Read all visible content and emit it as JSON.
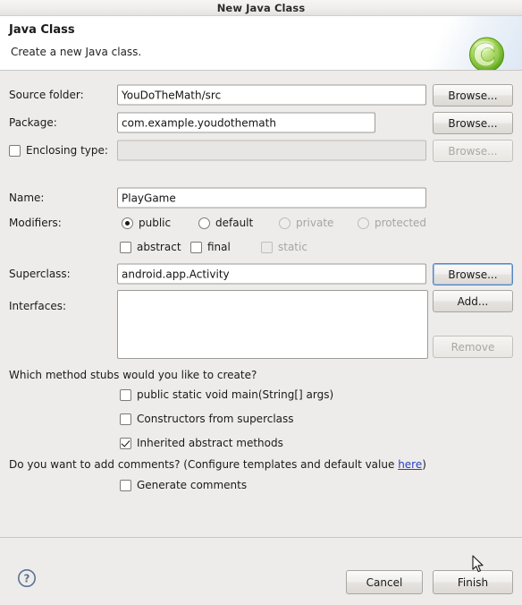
{
  "window": {
    "title": "New Java Class"
  },
  "header": {
    "title": "Java Class",
    "subtitle": "Create a new Java class.",
    "icon": "java-class-icon"
  },
  "form": {
    "source_folder": {
      "label": "Source folder:",
      "value": "YouDoTheMath/src",
      "browse_label": "Browse..."
    },
    "package": {
      "label": "Package:",
      "value": "com.example.youdothemath",
      "browse_label": "Browse..."
    },
    "enclosing_type": {
      "label": "Enclosing type:",
      "value": "",
      "checked": false,
      "browse_label": "Browse...",
      "enabled": false
    },
    "name": {
      "label": "Name:",
      "value": "PlayGame"
    },
    "modifiers": {
      "label": "Modifiers:",
      "radios": [
        {
          "label": "public",
          "selected": true,
          "enabled": true
        },
        {
          "label": "default",
          "selected": false,
          "enabled": true
        },
        {
          "label": "private",
          "selected": false,
          "enabled": false
        },
        {
          "label": "protected",
          "selected": false,
          "enabled": false
        }
      ],
      "checkboxes": [
        {
          "label": "abstract",
          "checked": false,
          "enabled": true
        },
        {
          "label": "final",
          "checked": false,
          "enabled": true
        },
        {
          "label": "static",
          "checked": false,
          "enabled": false
        }
      ]
    },
    "superclass": {
      "label": "Superclass:",
      "value": "android.app.Activity",
      "browse_label": "Browse...",
      "browse_focused": true
    },
    "interfaces": {
      "label": "Interfaces:",
      "items": [],
      "add_label": "Add...",
      "remove_label": "Remove",
      "remove_enabled": false
    }
  },
  "stubs": {
    "question": "Which method stubs would you like to create?",
    "options": [
      {
        "label": "public static void main(String[] args)",
        "checked": false
      },
      {
        "label": "Constructors from superclass",
        "checked": false
      },
      {
        "label": "Inherited abstract methods",
        "checked": true
      }
    ]
  },
  "comments": {
    "question_prefix": "Do you want to add comments? (Configure templates and default value ",
    "link_label": "here",
    "question_suffix": ")",
    "option": {
      "label": "Generate comments",
      "checked": false
    }
  },
  "footer": {
    "help_icon": "help-question-icon",
    "cancel_label": "Cancel",
    "finish_label": "Finish"
  },
  "colors": {
    "dialog_bg": "#edeceb",
    "header_bg": "#ffffff",
    "focus_border": "#5a84bd",
    "link": "#2b40bb",
    "icon_green": "#72c02c"
  }
}
